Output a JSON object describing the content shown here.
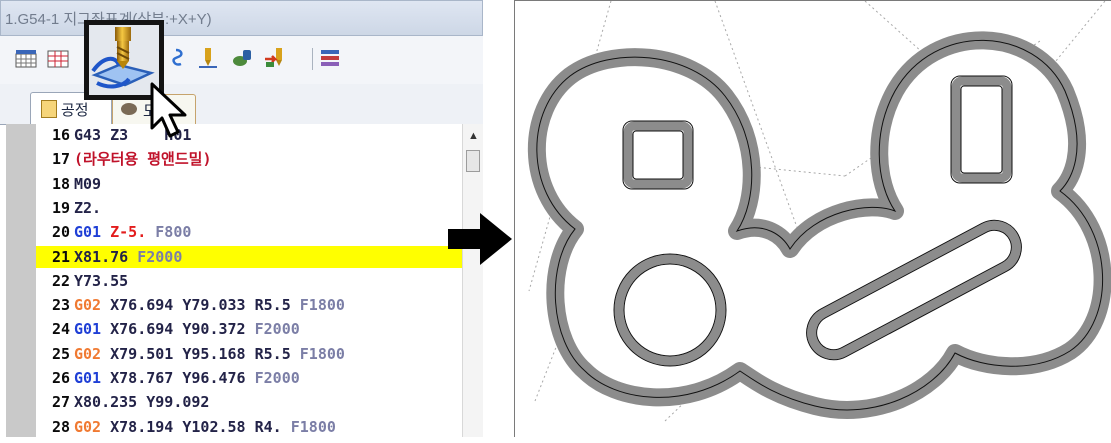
{
  "window": {
    "title": "1.G54-1 지그좌표계(상부:+X+Y)"
  },
  "toolbar": {
    "icons": [
      "grid-icon",
      "table-icon",
      "endmill-toolpath-icon",
      "spiral-icon",
      "drill-icon",
      "tool-paint-icon",
      "mill-export-icon",
      "stack-icon"
    ]
  },
  "tabs": [
    {
      "label": "공정",
      "active": true
    },
    {
      "label": "도구",
      "active": false
    }
  ],
  "code_lines": [
    {
      "num": "16",
      "tokens": [
        {
          "t": "G43 Z3",
          "c": "t-dark"
        },
        {
          "t": "    H01",
          "c": "t-dark"
        }
      ]
    },
    {
      "num": "17",
      "tokens": [
        {
          "t": "(라우터용 평앤드밀)",
          "c": "t-rpar"
        }
      ]
    },
    {
      "num": "18",
      "tokens": [
        {
          "t": "M09",
          "c": "t-dark"
        }
      ]
    },
    {
      "num": "19",
      "tokens": [
        {
          "t": "Z2.",
          "c": "t-dark"
        }
      ]
    },
    {
      "num": "20",
      "tokens": [
        {
          "t": "G01",
          "c": "g-blue"
        },
        {
          "t": " ",
          "c": ""
        },
        {
          "t": "Z-5.",
          "c": "t-red"
        },
        {
          "t": " ",
          "c": ""
        },
        {
          "t": "F800",
          "c": "t-feed"
        }
      ]
    },
    {
      "num": "21",
      "highlight": true,
      "tokens": [
        {
          "t": "X81.76",
          "c": "t-dark"
        },
        {
          "t": " ",
          "c": ""
        },
        {
          "t": "F2000",
          "c": "t-feed"
        }
      ]
    },
    {
      "num": "22",
      "tokens": [
        {
          "t": "Y73.55",
          "c": "t-dark"
        }
      ]
    },
    {
      "num": "23",
      "tokens": [
        {
          "t": "G02",
          "c": "g-orange"
        },
        {
          "t": " X76.694 Y79.033 R5.5 ",
          "c": "t-dark"
        },
        {
          "t": "F1800",
          "c": "t-feed"
        }
      ]
    },
    {
      "num": "24",
      "tokens": [
        {
          "t": "G01",
          "c": "g-blue"
        },
        {
          "t": " X76.694 Y90.372 ",
          "c": "t-dark"
        },
        {
          "t": "F2000",
          "c": "t-feed"
        }
      ]
    },
    {
      "num": "25",
      "tokens": [
        {
          "t": "G02",
          "c": "g-orange"
        },
        {
          "t": " X79.501 Y95.168 R5.5 ",
          "c": "t-dark"
        },
        {
          "t": "F1800",
          "c": "t-feed"
        }
      ]
    },
    {
      "num": "26",
      "tokens": [
        {
          "t": "G01",
          "c": "g-blue"
        },
        {
          "t": " X78.767 Y96.476 ",
          "c": "t-dark"
        },
        {
          "t": "F2000",
          "c": "t-feed"
        }
      ]
    },
    {
      "num": "27",
      "tokens": [
        {
          "t": "X80.235 Y99.092",
          "c": "t-dark"
        }
      ]
    },
    {
      "num": "28",
      "tokens": [
        {
          "t": "G02",
          "c": "g-orange"
        },
        {
          "t": " X78.194 Y102.58 R4. ",
          "c": "t-dark"
        },
        {
          "t": "F1800",
          "c": "t-feed"
        }
      ]
    }
  ],
  "scrollbar": {
    "up_arrow": "▲"
  },
  "callout": {
    "icon": "endmill-toolpath-icon"
  },
  "arrow": {
    "icon": "right-arrow-icon",
    "color": "#000000"
  },
  "drawing": {
    "part_fill": "#ffffff",
    "outline_color": "#8c8c8c",
    "guide_color": "#a8a8a8"
  }
}
